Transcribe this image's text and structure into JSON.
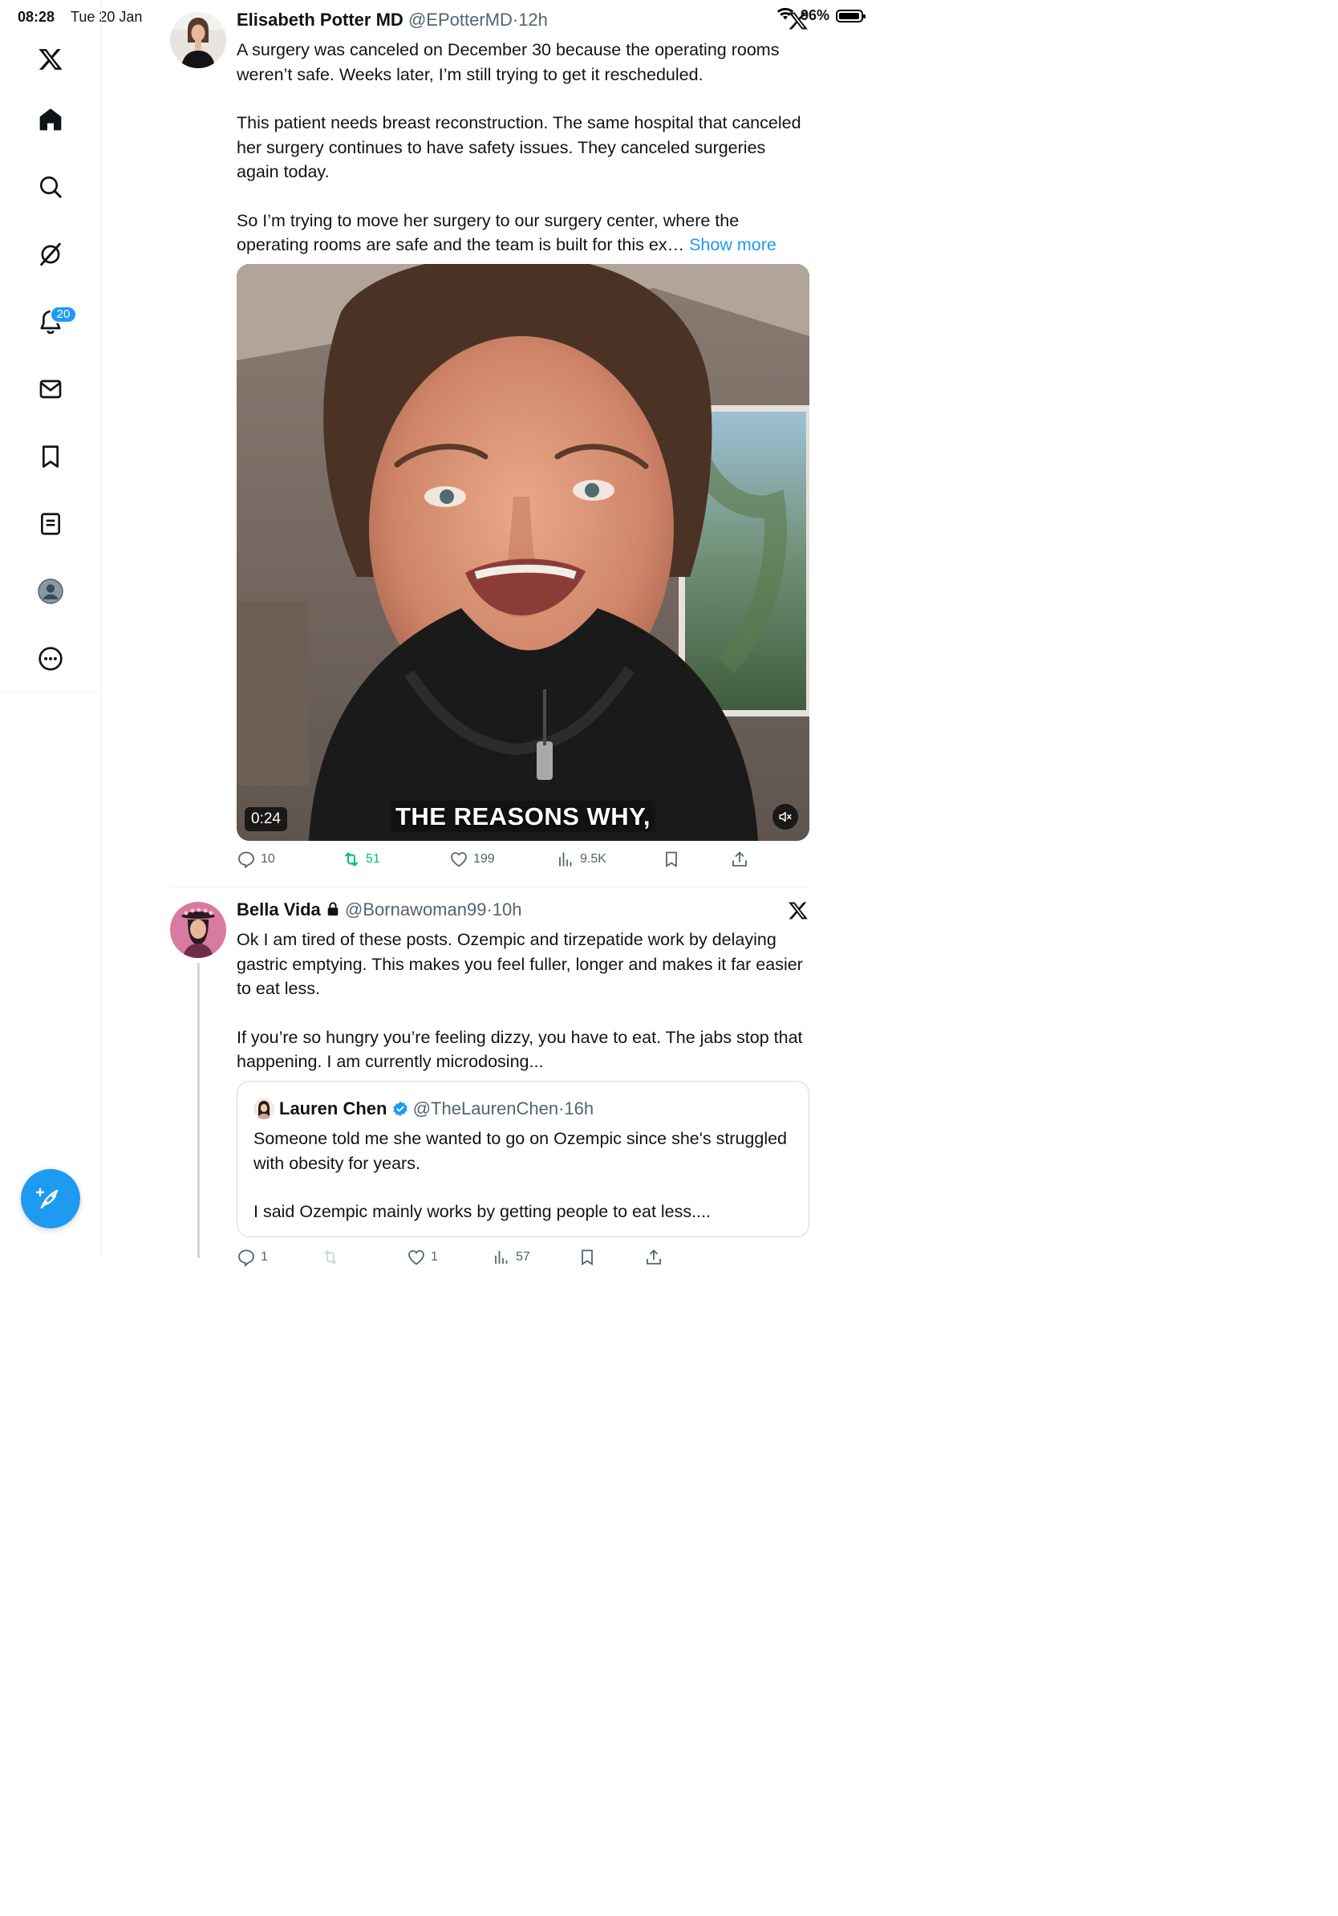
{
  "status_bar": {
    "time": "08:28",
    "date": "Tue 20 Jan",
    "battery": "96%",
    "battery_level": 0.96
  },
  "sidebar": {
    "items": [
      {
        "name": "x-logo",
        "icon": "x-logo-icon"
      },
      {
        "name": "home",
        "icon": "home-icon"
      },
      {
        "name": "search",
        "icon": "search-icon"
      },
      {
        "name": "grok",
        "icon": "grok-icon"
      },
      {
        "name": "notifications",
        "icon": "bell-icon",
        "badge": "20"
      },
      {
        "name": "messages",
        "icon": "envelope-icon"
      },
      {
        "name": "bookmarks",
        "icon": "bookmark-icon"
      },
      {
        "name": "lists",
        "icon": "list-icon"
      },
      {
        "name": "profile",
        "icon": "avatar-icon"
      },
      {
        "name": "more",
        "icon": "more-circle-icon"
      }
    ],
    "compose_icon": "compose-icon"
  },
  "tweets": [
    {
      "display_name": "Elisabeth Potter MD",
      "handle": "@EPotterMD",
      "separator": "·",
      "time": "12h",
      "paragraphs": [
        "A surgery was canceled on December 30 because the operating rooms weren’t safe. Weeks later, I’m still trying to get it rescheduled.",
        "This patient needs breast reconstruction. The same hospital that canceled her surgery continues to have safety issues. They canceled surgeries again today.",
        "So I’m trying to move her surgery to our surgery center, where the operating rooms are safe and the team is built for this ex…"
      ],
      "show_more": "Show more",
      "media": {
        "duration": "0:24",
        "caption": "THE REASONS WHY,"
      },
      "actions": {
        "replies": "10",
        "reposts": "51",
        "likes": "199",
        "views": "9.5K"
      }
    },
    {
      "display_name": "Bella Vida",
      "handle": "@Bornawoman99",
      "separator": "·",
      "time": "10h",
      "paragraphs": [
        "Ok I am tired of these posts. Ozempic and tirzepatide work by delaying gastric emptying. This makes you feel fuller, longer and makes it far easier to eat less.",
        "If you’re so hungry you’re feeling dizzy, you have to eat. The jabs stop that happening. I am currently microdosing..."
      ],
      "quote": {
        "display_name": "Lauren Chen",
        "handle": "@TheLaurenChen",
        "separator": "·",
        "time": "16h",
        "paragraphs": [
          "Someone told me she wanted to go on Ozempic since she's struggled with obesity for years.",
          "I said Ozempic mainly works by getting people to eat less...."
        ]
      },
      "actions": {
        "replies": "1",
        "likes": "1",
        "views": "57"
      }
    }
  ]
}
